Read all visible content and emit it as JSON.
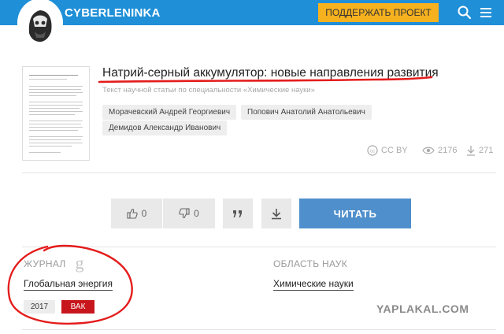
{
  "header": {
    "logo": "CYBERLENINKA",
    "support_button": "ПОДДЕРЖАТЬ ПРОЕКТ",
    "icons": [
      "search-icon",
      "menu-icon"
    ],
    "colors": {
      "bar": "#1f8fd8",
      "support_button": "#f6b11f"
    }
  },
  "article": {
    "title": "Натрий-серный аккумулятор: новые направления развития",
    "subtitle": "Текст научной статьи по специальности «Химические науки»",
    "authors": [
      "Морачевский Андрей Георгиевич",
      "Попович Анатолий Анатольевич",
      "Демидов Александр Иванович"
    ],
    "license": "CC BY",
    "views": "2176",
    "downloads": "271"
  },
  "actions": {
    "likes": "0",
    "dislikes": "0",
    "read_button": "ЧИТАТЬ",
    "read_color": "#4f8fcc"
  },
  "meta": {
    "journal_label": "ЖУРНАЛ",
    "journal_name": "Глобальная энергия",
    "year": "2017",
    "vak_badge": "ВАК",
    "field_label": "ОБЛАСТЬ НАУК",
    "field_name": "Химические науки"
  },
  "watermark": "YAPLAKAL.COM"
}
